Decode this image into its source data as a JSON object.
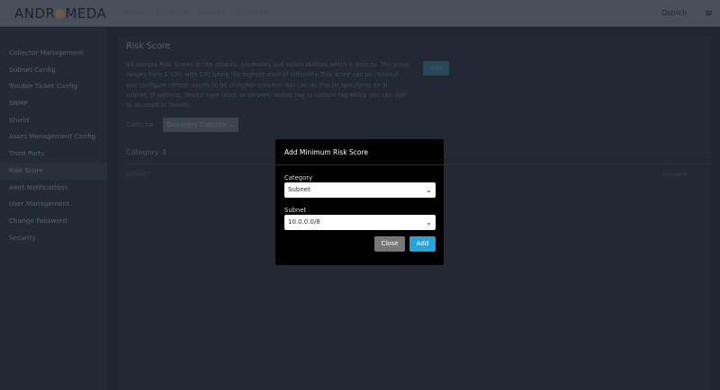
{
  "header": {
    "logo": "ANDROMEDA",
    "nav": [
      "HOME",
      "THREATS",
      "ASSETS",
      "REPORTS"
    ],
    "user": "Ostrich"
  },
  "sidebar": {
    "items": [
      "Collector Management",
      "Subnet Config",
      "Trouble Ticket Config",
      "SNMP",
      "Shield",
      "Asset Management Config",
      "Third Party",
      "Risk Score",
      "Alert Notifications",
      "User Management",
      "Change Password",
      "Security"
    ],
    "active": "Risk Score"
  },
  "main": {
    "title": "Risk Score",
    "description": "A3 assigns Risk Scores to the attacks, anomalies and vulnerabilities which it detects. The score ranges from 1-100, with 100 being the highest level of criticality. This score can be raised if you configure certain assets to be of higher concern. You can do this by specifying an IP subnet, IP address, device type (such as servers) and/or tag (a custom tag which you can add to an asset or threat).",
    "add_label": "Add",
    "collector_label": "Collector",
    "collector_value": "Discovery Collector",
    "column_category": "Category",
    "row_category": "SUBNET",
    "row_action": "Remove"
  },
  "modal": {
    "title": "Add Minimum Risk Score",
    "category_label": "Category",
    "category_value": "Subnet",
    "subnet_label": "Subnet",
    "subnet_value": "10.0.0.0/8",
    "close_label": "Close",
    "add_label": "Add"
  }
}
